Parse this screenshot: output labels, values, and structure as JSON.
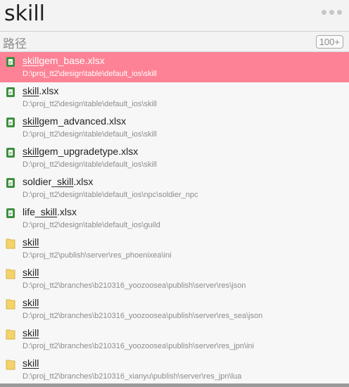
{
  "search": {
    "query": "skill"
  },
  "header": {
    "label": "路径",
    "count_badge": "100+"
  },
  "results": [
    {
      "icon": "excel-file-icon",
      "match": "skill",
      "rest": "gem_base.xlsx",
      "prefix": "",
      "path": "D:\\proj_tt2\\design\\table\\default_ios\\skill",
      "selected": true
    },
    {
      "icon": "excel-file-icon",
      "match": "skill",
      "rest": ".xlsx",
      "prefix": "",
      "path": "D:\\proj_tt2\\design\\table\\default_ios\\skill"
    },
    {
      "icon": "excel-file-icon",
      "match": "skill",
      "rest": "gem_advanced.xlsx",
      "prefix": "",
      "path": "D:\\proj_tt2\\design\\table\\default_ios\\skill"
    },
    {
      "icon": "excel-file-icon",
      "match": "skill",
      "rest": "gem_upgradetype.xlsx",
      "prefix": "",
      "path": "D:\\proj_tt2\\design\\table\\default_ios\\skill"
    },
    {
      "icon": "excel-file-icon",
      "match": "skill",
      "rest": ".xlsx",
      "prefix": "soldier_",
      "path": "D:\\proj_tt2\\design\\table\\default_ios\\npc\\soldier_npc"
    },
    {
      "icon": "excel-file-icon",
      "match": "skill",
      "rest": ".xlsx",
      "prefix": "life_",
      "path": "D:\\proj_tt2\\design\\table\\default_ios\\guild"
    },
    {
      "icon": "folder-icon",
      "match": "skill",
      "rest": "",
      "prefix": "",
      "path": "D:\\proj_tt2\\publish\\server\\res_phoenixea\\ini"
    },
    {
      "icon": "folder-icon",
      "match": "skill",
      "rest": "",
      "prefix": "",
      "path": "D:\\proj_tt2\\branches\\b210316_yoozoosea\\publish\\server\\res\\json"
    },
    {
      "icon": "folder-icon",
      "match": "skill",
      "rest": "",
      "prefix": "",
      "path": "D:\\proj_tt2\\branches\\b210316_yoozoosea\\publish\\server\\res_sea\\json"
    },
    {
      "icon": "folder-icon",
      "match": "skill",
      "rest": "",
      "prefix": "",
      "path": "D:\\proj_tt2\\branches\\b210316_yoozoosea\\publish\\server\\res_jpn\\ini"
    },
    {
      "icon": "folder-icon",
      "match": "skill",
      "rest": "",
      "prefix": "",
      "path": "D:\\proj_tt2\\branches\\b210316_xianyu\\publish\\server\\res_jpn\\lua"
    }
  ],
  "colors": {
    "selected": "#fd8295",
    "excel": "#3f8f3f",
    "folder": "#f3d36a"
  }
}
